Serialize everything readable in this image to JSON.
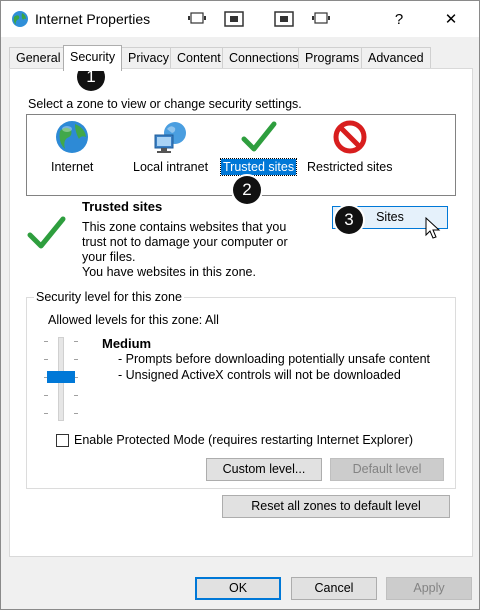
{
  "window": {
    "title": "Internet Properties",
    "help_glyph": "?",
    "close_glyph": "✕"
  },
  "tabs": [
    {
      "label": "General"
    },
    {
      "label": "Security"
    },
    {
      "label": "Privacy"
    },
    {
      "label": "Content"
    },
    {
      "label": "Connections"
    },
    {
      "label": "Programs"
    },
    {
      "label": "Advanced"
    }
  ],
  "active_tab": "Security",
  "security": {
    "zone_prompt": "Select a zone to view or change security settings.",
    "zones": [
      {
        "label": "Internet",
        "icon": "globe-icon"
      },
      {
        "label": "Local intranet",
        "icon": "intranet-icon"
      },
      {
        "label": "Trusted sites",
        "icon": "check-icon"
      },
      {
        "label": "Restricted sites",
        "icon": "restricted-icon"
      }
    ],
    "selected_zone": "Trusted sites",
    "zone_title": "Trusted sites",
    "zone_description": [
      "This zone contains websites that you",
      "trust not to damage your computer or",
      "your files.",
      "You have websites in this zone."
    ],
    "sites_button": "Sites",
    "level_group_label": "Security level for this zone",
    "allowed_levels": "Allowed levels for this zone: All",
    "level_name": "Medium",
    "level_details": [
      "- Prompts before downloading potentially unsafe content",
      "- Unsigned ActiveX controls will not be downloaded"
    ],
    "protected_mode_label": "Enable Protected Mode (requires restarting Internet Explorer)",
    "protected_mode_checked": false,
    "custom_level_button": "Custom level...",
    "default_level_button": "Default level",
    "reset_button": "Reset all zones to default level"
  },
  "footer": {
    "ok": "OK",
    "cancel": "Cancel",
    "apply": "Apply"
  },
  "callouts": [
    "1",
    "2",
    "3"
  ],
  "colors": {
    "accent": "#0078d7",
    "check_green": "#2e9e3e",
    "restricted_red": "#d81e1e"
  }
}
